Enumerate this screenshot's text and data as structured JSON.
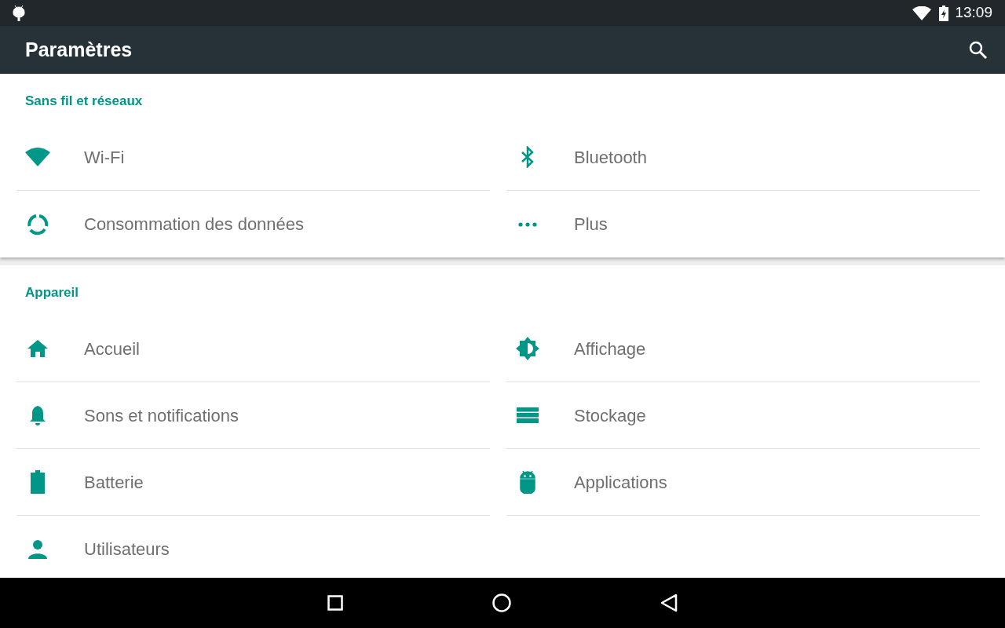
{
  "status_bar": {
    "time": "13:09"
  },
  "app_bar": {
    "title": "Paramètres"
  },
  "sections": [
    {
      "title": "Sans fil et réseaux",
      "items": [
        {
          "label": "Wi-Fi",
          "kind": "wifi"
        },
        {
          "label": "Bluetooth",
          "kind": "bluetooth"
        },
        {
          "label": "Consommation des données",
          "kind": "data"
        },
        {
          "label": "Plus",
          "kind": "more"
        }
      ]
    },
    {
      "title": "Appareil",
      "items": [
        {
          "label": "Accueil",
          "kind": "home"
        },
        {
          "label": "Affichage",
          "kind": "display"
        },
        {
          "label": "Sons et notifications",
          "kind": "bell"
        },
        {
          "label": "Stockage",
          "kind": "storage"
        },
        {
          "label": "Batterie",
          "kind": "battery"
        },
        {
          "label": "Applications",
          "kind": "apps"
        },
        {
          "label": "Utilisateurs",
          "kind": "user"
        }
      ]
    }
  ]
}
